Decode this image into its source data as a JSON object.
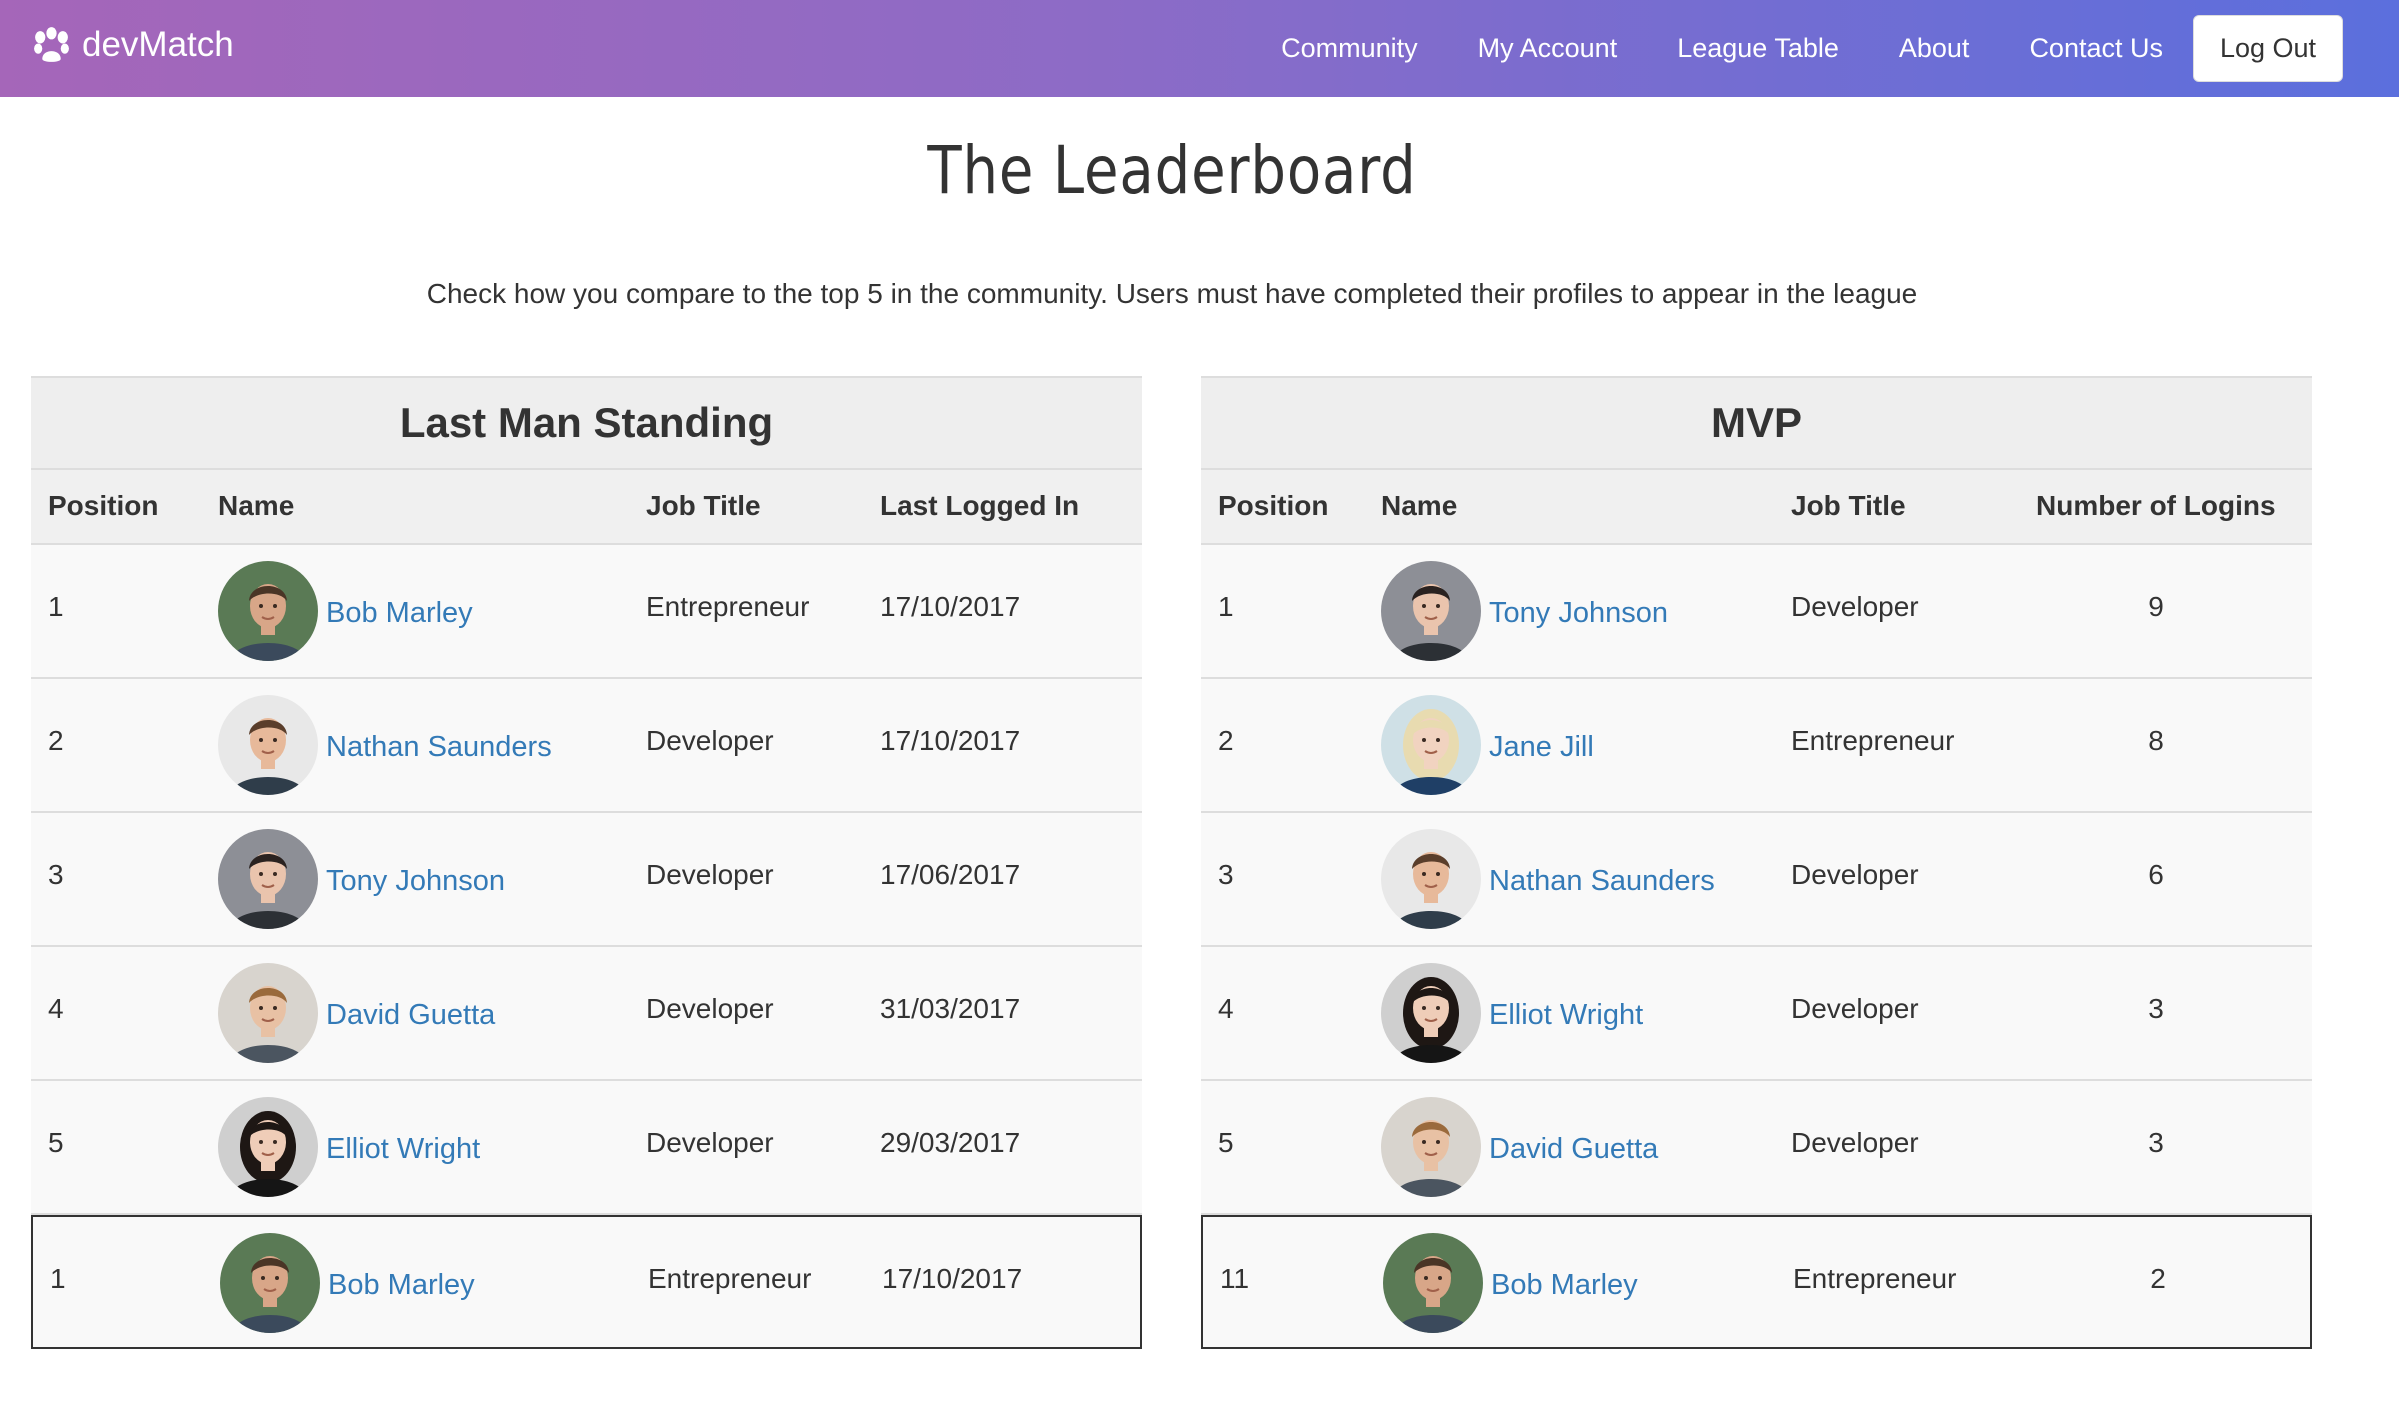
{
  "navbar": {
    "brand": "devMatch",
    "links": [
      "Community",
      "My Account",
      "League Table",
      "About",
      "Contact Us"
    ],
    "logout": "Log Out"
  },
  "page": {
    "title": "The Leaderboard",
    "subtitle": "Check how you compare to the top 5 in the community. Users must have completed their profiles to appear in the league"
  },
  "last_man_standing": {
    "title": "Last Man Standing",
    "headers": [
      "Position",
      "Name",
      "Job Title",
      "Last Logged In"
    ],
    "rows": [
      {
        "position": "1",
        "name": "Bob Marley",
        "job": "Entrepreneur",
        "value": "17/10/2017",
        "avatar": "bob"
      },
      {
        "position": "2",
        "name": "Nathan Saunders",
        "job": "Developer",
        "value": "17/10/2017",
        "avatar": "nathan"
      },
      {
        "position": "3",
        "name": "Tony Johnson",
        "job": "Developer",
        "value": "17/06/2017",
        "avatar": "tony"
      },
      {
        "position": "4",
        "name": "David Guetta",
        "job": "Developer",
        "value": "31/03/2017",
        "avatar": "david"
      },
      {
        "position": "5",
        "name": "Elliot Wright",
        "job": "Developer",
        "value": "29/03/2017",
        "avatar": "elliot"
      }
    ],
    "current_user": {
      "position": "1",
      "name": "Bob Marley",
      "job": "Entrepreneur",
      "value": "17/10/2017",
      "avatar": "bob"
    }
  },
  "mvp": {
    "title": "MVP",
    "headers": [
      "Position",
      "Name",
      "Job Title",
      "Number of Logins"
    ],
    "rows": [
      {
        "position": "1",
        "name": "Tony Johnson",
        "job": "Developer",
        "value": "9",
        "avatar": "tony"
      },
      {
        "position": "2",
        "name": "Jane Jill",
        "job": "Entrepreneur",
        "value": "8",
        "avatar": "jane"
      },
      {
        "position": "3",
        "name": "Nathan Saunders",
        "job": "Developer",
        "value": "6",
        "avatar": "nathan"
      },
      {
        "position": "4",
        "name": "Elliot Wright",
        "job": "Developer",
        "value": "3",
        "avatar": "elliot"
      },
      {
        "position": "5",
        "name": "David Guetta",
        "job": "Developer",
        "value": "3",
        "avatar": "david"
      }
    ],
    "current_user": {
      "position": "11",
      "name": "Bob Marley",
      "job": "Entrepreneur",
      "value": "2",
      "avatar": "bob"
    }
  },
  "colors": {
    "nav_gradient_start": "#a566b9",
    "nav_gradient_end": "#5b6fdd",
    "link": "#337ab7"
  }
}
